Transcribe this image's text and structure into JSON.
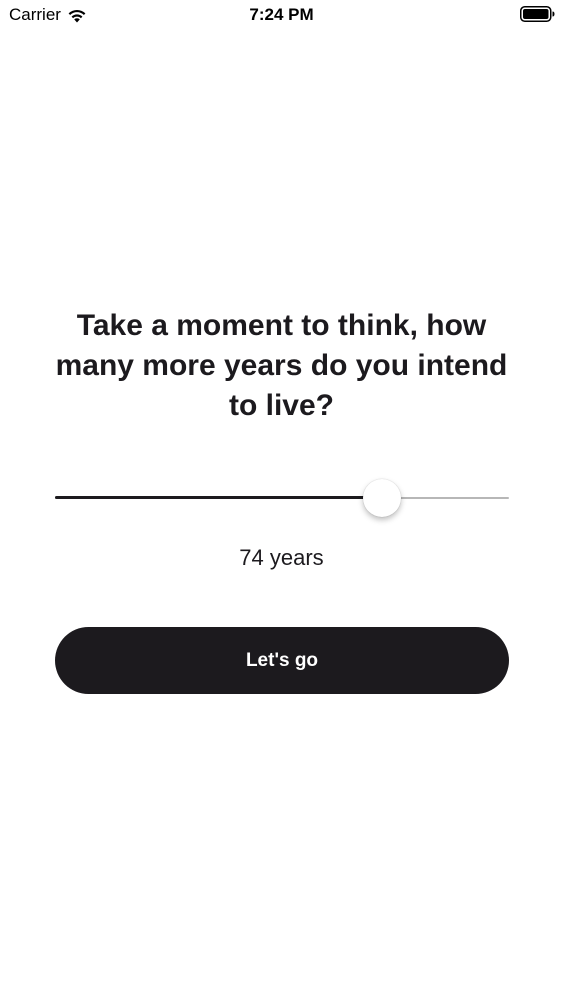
{
  "status_bar": {
    "carrier": "Carrier",
    "time": "7:24 PM",
    "wifi_icon": "wifi-icon",
    "battery_icon": "battery-icon"
  },
  "question": {
    "text": "Take a moment to think, how many more years do you intend to live?"
  },
  "slider": {
    "fraction": 0.72,
    "fill_color": "#1c1a1e",
    "track_color": "#b7b7b7"
  },
  "readout": {
    "text": "74 years"
  },
  "button": {
    "label": "Let's go",
    "color": "#1c1a1e"
  }
}
